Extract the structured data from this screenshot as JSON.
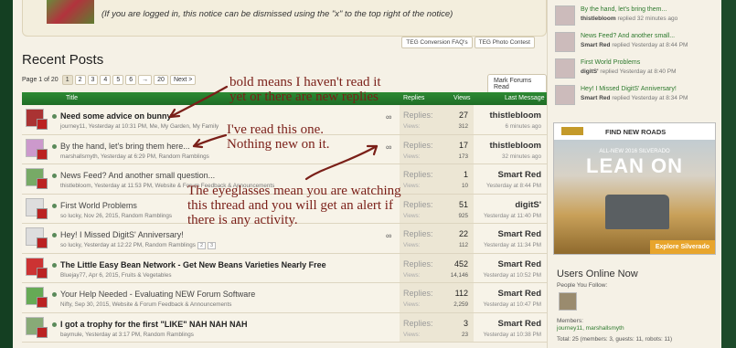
{
  "notice": {
    "message": "(If you are logged in, this notice can be dismissed using the \"x\" to the top right of the notice)",
    "tabs": [
      "TEG Conversion FAQ's",
      "TEG Photo Contest"
    ]
  },
  "section_title": "Recent Posts",
  "pager": {
    "label": "Page 1 of 20",
    "pages": [
      "1",
      "2",
      "3",
      "4",
      "5",
      "6",
      "→",
      "20",
      "Next >"
    ]
  },
  "mark_read_label": "Mark Forums Read",
  "table_header": {
    "title": "Title",
    "replies": "Replies",
    "views": "Views",
    "last": "Last Message"
  },
  "threads": [
    {
      "title": "Need some advice on bunny",
      "bold": true,
      "meta": "journey11, Yesterday at 10:31 PM, Me, My Garden, My Family",
      "replies": "27",
      "views": "312",
      "last_user": "thistlebloom",
      "last_time": "6 minutes ago",
      "watching": true,
      "replies_label": "Replies:",
      "views_label": "Views:"
    },
    {
      "title": "By the hand, let's bring them here...",
      "bold": false,
      "meta": "marshallsmyth, Yesterday at 6:29 PM, Random Ramblings",
      "replies": "17",
      "views": "173",
      "last_user": "thistlebloom",
      "last_time": "32 minutes ago",
      "watching": true,
      "replies_label": "Replies:",
      "views_label": "Views:"
    },
    {
      "title": "News Feed? And another small question...",
      "bold": false,
      "meta": "thistlebloom, Yesterday at 11:53 PM, Website & Forum Feedback & Announcements",
      "replies": "1",
      "views": "10",
      "last_user": "Smart Red",
      "last_time": "Yesterday at 8:44 PM",
      "watching": false,
      "replies_label": "Replies:",
      "views_label": "Views:"
    },
    {
      "title": "First World Problems",
      "bold": false,
      "meta": "so lucky, Nov 26, 2015, Random Ramblings",
      "replies": "51",
      "views": "925",
      "last_user": "digitS'",
      "last_time": "Yesterday at 11:40 PM",
      "watching": false,
      "replies_label": "Replies:",
      "views_label": "Views:"
    },
    {
      "title": "Hey! I Missed DigitS' Anniversary!",
      "bold": false,
      "meta": "so lucky, Yesterday at 12:22 PM, Random Ramblings",
      "replies": "22",
      "views": "112",
      "last_user": "Smart Red",
      "last_time": "Yesterday at 11:34 PM",
      "watching": true,
      "pages": [
        "2",
        "3"
      ],
      "replies_label": "Replies:",
      "views_label": "Views:"
    },
    {
      "title": "The Little Easy Bean Network - Get New Beans Varieties Nearly Free",
      "bold": true,
      "meta": "Bluejay77, Apr 6, 2015, Fruits & Vegetables",
      "replies": "452",
      "views": "14,146",
      "last_user": "Smart Red",
      "last_time": "Yesterday at 10:52 PM",
      "watching": false,
      "replies_label": "Replies:",
      "views_label": "Views:"
    },
    {
      "title": "Your Help Needed - Evaluating NEW Forum Software",
      "bold": false,
      "meta": "Nifty, Sep 30, 2015, Website & Forum Feedback & Announcements",
      "replies": "112",
      "views": "2,259",
      "last_user": "Smart Red",
      "last_time": "Yesterday at 10:47 PM",
      "watching": false,
      "replies_label": "Replies:",
      "views_label": "Views:"
    },
    {
      "title": "I got a trophy for the first \"LIKE\" NAH NAH NAH",
      "bold": true,
      "meta": "baymule, Yesterday at 3:17 PM, Random Ramblings",
      "replies": "3",
      "views": "23",
      "last_user": "Smart Red",
      "last_time": "Yesterday at 10:38 PM",
      "watching": false,
      "replies_label": "Replies:",
      "views_label": "Views:"
    }
  ],
  "annotations": {
    "bold": "bold means I haven't read it\nyet or there are new replies",
    "read": "I've read this one.\nNothing new on it.",
    "glasses": "The eyeglasses mean you are watching\nthis thread and you will get an alert if\nthere is any activity."
  },
  "sidebar": {
    "recent": [
      {
        "title": "By the hand, let's bring them...",
        "user": "thistlebloom",
        "time": "replied 32 minutes ago"
      },
      {
        "title": "News Feed? And another small...",
        "user": "Smart Red",
        "time": "replied Yesterday at 8:44 PM"
      },
      {
        "title": "First World Problems",
        "user": "digitS'",
        "time": "replied Yesterday at 8:40 PM"
      },
      {
        "title": "Hey! I Missed DigitS' Anniversary!",
        "user": "Smart Red",
        "time": "replied Yesterday at 8:34 PM"
      }
    ],
    "ad": {
      "brand": "FIND NEW ROADS",
      "subtitle": "ALL-NEW 2016 SILVERADO",
      "headline": "LEAN ON",
      "cta": "Explore Silverado"
    },
    "users_online": {
      "title": "Users Online Now",
      "follow_label": "People You Follow:",
      "members_label": "Members:",
      "members": "journey11, marshallsmyth",
      "total": "Total: 25 (members: 3, guests: 11, robots: 11)"
    }
  }
}
